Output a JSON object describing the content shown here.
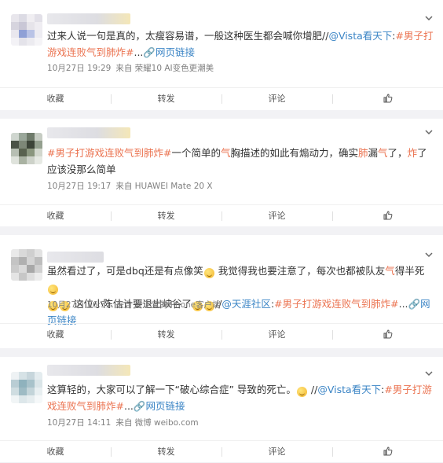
{
  "posts": [
    {
      "text_parts": [
        {
          "t": "过来人说一句是真的，太瘦容易谱，一般这种医生都会喊你增肥//",
          "c": ""
        },
        {
          "t": "@Vista看天下",
          "c": "blue"
        },
        {
          "t": ":",
          "c": ""
        },
        {
          "t": "#男子打游戏连败气到肺炸#",
          "c": "link"
        },
        {
          "t": "...",
          "c": ""
        },
        {
          "t": "🔗网页链接",
          "c": "blue"
        }
      ],
      "time": "10月27日 19:29",
      "source": "来自 荣耀10 AI变色更潮美",
      "actions": [
        "收藏",
        "转发",
        "评论",
        ""
      ]
    },
    {
      "text_parts": [
        {
          "t": "#男子打游戏连败气到肺炸#",
          "c": "link"
        },
        {
          "t": "一个简单的",
          "c": ""
        },
        {
          "t": "气",
          "c": "link"
        },
        {
          "t": "胸描述的如此有煽动力，确实",
          "c": ""
        },
        {
          "t": "肺",
          "c": "link"
        },
        {
          "t": "漏",
          "c": ""
        },
        {
          "t": "气",
          "c": "link"
        },
        {
          "t": "了，",
          "c": ""
        },
        {
          "t": "炸",
          "c": "link"
        },
        {
          "t": "了应该没那么简单",
          "c": ""
        }
      ],
      "time": "10月27日 19:17",
      "source": "来自 HUAWEI Mate 20 X",
      "actions": [
        "收藏",
        "转发",
        "评论",
        ""
      ]
    },
    {
      "text_parts": [
        {
          "t": "虽然看过了，可是dbq还是有点像笑",
          "c": ""
        },
        {
          "t": "[emo]",
          "c": "emo"
        },
        {
          "t": " 我觉得我也要注意了，每次也都被队友",
          "c": ""
        },
        {
          "t": "气",
          "c": "link"
        },
        {
          "t": "得半死",
          "c": ""
        },
        {
          "t": "[emo]",
          "c": "emo"
        },
        {
          "t": "\n",
          "c": ""
        },
        {
          "t": "[emo]",
          "c": "emo"
        },
        {
          "t": "[emo]",
          "c": "emo"
        },
        {
          "t": " 这位小陈估计要退出峡谷了",
          "c": ""
        },
        {
          "t": "[emo]",
          "c": "emo"
        },
        {
          "t": "[emo]",
          "c": "emo"
        },
        {
          "t": "//",
          "c": ""
        },
        {
          "t": "@天涯社区",
          "c": "blue"
        },
        {
          "t": ":",
          "c": ""
        },
        {
          "t": "#男子打游戏连败气到肺炸#",
          "c": "link"
        },
        {
          "t": "...",
          "c": ""
        },
        {
          "t": "🔗网页链接",
          "c": "blue"
        }
      ],
      "time": "10月27日 16:31",
      "source": "来自 爱丁宝的iPhone客户端",
      "actions": [
        "收藏",
        "转发",
        "评论",
        ""
      ]
    },
    {
      "text_parts": [
        {
          "t": "这算轻的，大家可以了解一下“破心综合症” 导致的死亡。",
          "c": ""
        },
        {
          "t": "[emo]",
          "c": "emo"
        },
        {
          "t": " //",
          "c": ""
        },
        {
          "t": "@Vista看天下",
          "c": "blue"
        },
        {
          "t": ":",
          "c": ""
        },
        {
          "t": "#男子打游戏连败气到肺炸#",
          "c": "link"
        },
        {
          "t": "...",
          "c": ""
        },
        {
          "t": "🔗网页链接",
          "c": "blue"
        }
      ],
      "time": "10月27日 14:11",
      "source": "来自 微博 weibo.com",
      "actions": [
        "收藏",
        "转发",
        "评论",
        ""
      ]
    }
  ],
  "colors": {
    "link": "#eb7350",
    "blue": "#3a84c5",
    "meta": "#808080",
    "bg": "#f2f2f5"
  },
  "icons": [
    "chevron-down-icon",
    "thumbs-up-icon",
    "emoji-icon",
    "link-icon"
  ]
}
